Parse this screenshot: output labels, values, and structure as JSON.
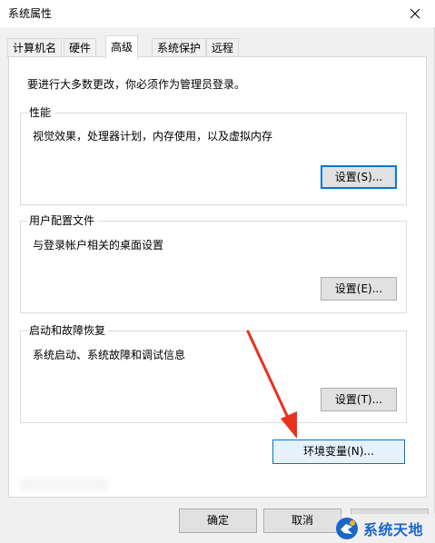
{
  "window": {
    "title": "系统属性"
  },
  "tabs": [
    {
      "label": "计算机名"
    },
    {
      "label": "硬件"
    },
    {
      "label": "高级",
      "active": true
    },
    {
      "label": "系统保护"
    },
    {
      "label": "远程"
    }
  ],
  "panel": {
    "admin_note": "要进行大多数更改，你必须作为管理员登录。",
    "performance": {
      "title": "性能",
      "description": "视觉效果，处理器计划，内存使用，以及虚拟内存",
      "button": "设置(S)..."
    },
    "user_profiles": {
      "title": "用户配置文件",
      "description": "与登录帐户相关的桌面设置",
      "button": "设置(E)..."
    },
    "startup_recovery": {
      "title": "启动和故障恢复",
      "description": "系统启动、系统故障和调试信息",
      "button": "设置(T)..."
    },
    "env_button": "环境变量(N)..."
  },
  "footer": {
    "ok": "确定",
    "cancel": "取消"
  },
  "watermark": {
    "text": "系统天地"
  },
  "icons": [
    "close-icon",
    "red-arrow-icon",
    "watermark-logo-icon"
  ],
  "colors": {
    "accent": "#0078d7",
    "arrow": "#e8321e",
    "watermark": "#1a66c9"
  }
}
